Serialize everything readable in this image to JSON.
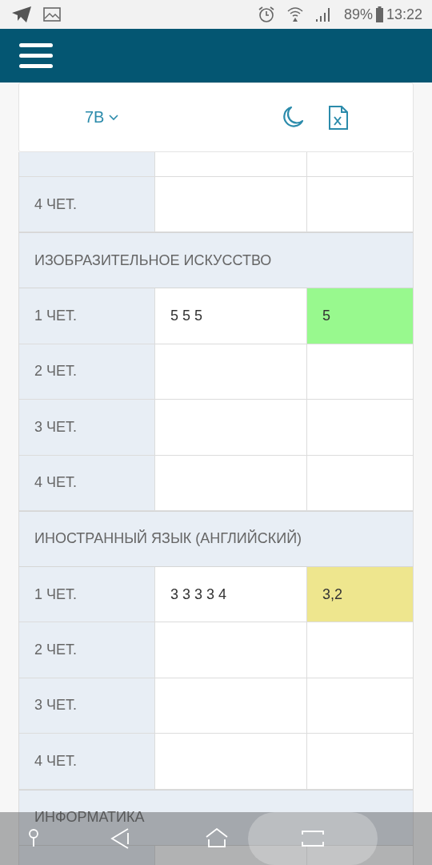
{
  "status_bar": {
    "battery": "89%",
    "time": "13:22"
  },
  "class_selector": {
    "label": "7В"
  },
  "sections": [
    {
      "rows": [
        {},
        {
          "label": "4 ЧЕТ."
        }
      ]
    },
    {
      "title": "ИЗОБРАЗИТЕЛЬНОЕ ИСКУССТВО",
      "rows": [
        {
          "label": "1 ЧЕТ.",
          "marks": "5 5 5",
          "average": "5",
          "color": "#98f98e"
        },
        {
          "label": "2 ЧЕТ."
        },
        {
          "label": "3 ЧЕТ."
        },
        {
          "label": "4 ЧЕТ."
        }
      ]
    },
    {
      "title": "ИНОСТРАННЫЙ ЯЗЫК (АНГЛИЙСКИЙ)",
      "rows": [
        {
          "label": "1 ЧЕТ.",
          "marks": "3 3 3 3 4",
          "average": "3,2",
          "color": "#eee68e"
        },
        {
          "label": "2 ЧЕТ."
        },
        {
          "label": "3 ЧЕТ."
        },
        {
          "label": "4 ЧЕТ."
        }
      ]
    },
    {
      "title": "ИНФОРМАТИКА",
      "rows": [
        {}
      ]
    }
  ]
}
